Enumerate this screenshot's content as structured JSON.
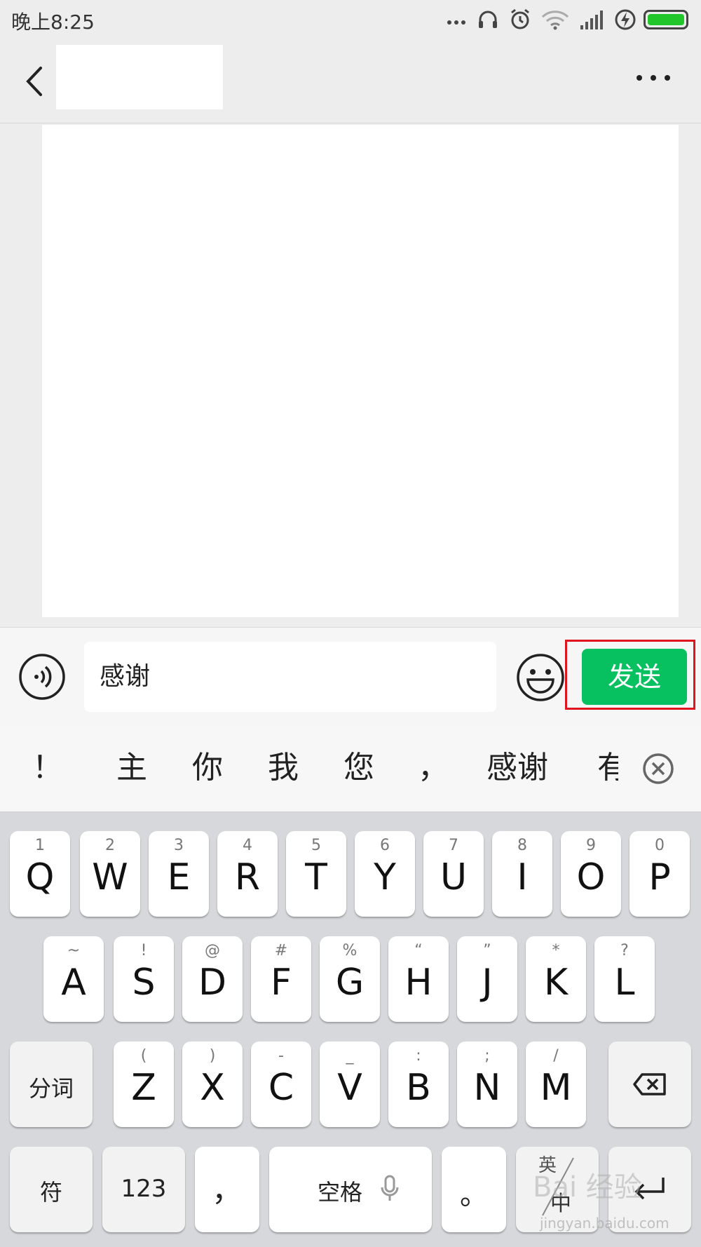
{
  "status_bar": {
    "time": "晚上8:25",
    "icons": [
      "more-dots-icon",
      "headset-icon",
      "alarm-icon",
      "wifi-icon",
      "signal-icon",
      "charging-icon",
      "battery-icon"
    ],
    "battery_color": "#21c62a"
  },
  "header": {
    "back_icon": "chevron-left-icon",
    "more_icon": "more-horizontal-icon"
  },
  "input_bar": {
    "message_value": "感谢",
    "send_label": "发送",
    "send_color": "#07c160",
    "highlight_color": "#e0141e"
  },
  "candidates": {
    "items": [
      "！",
      "主",
      "你",
      "我",
      "您",
      "，",
      "感谢",
      "有"
    ]
  },
  "keyboard": {
    "row1": [
      {
        "letter": "Q",
        "hint": "1"
      },
      {
        "letter": "W",
        "hint": "2"
      },
      {
        "letter": "E",
        "hint": "3"
      },
      {
        "letter": "R",
        "hint": "4"
      },
      {
        "letter": "T",
        "hint": "5"
      },
      {
        "letter": "Y",
        "hint": "6"
      },
      {
        "letter": "U",
        "hint": "7"
      },
      {
        "letter": "I",
        "hint": "8"
      },
      {
        "letter": "O",
        "hint": "9"
      },
      {
        "letter": "P",
        "hint": "0"
      }
    ],
    "row2": [
      {
        "letter": "A",
        "hint": "~"
      },
      {
        "letter": "S",
        "hint": "!"
      },
      {
        "letter": "D",
        "hint": "@"
      },
      {
        "letter": "F",
        "hint": "#"
      },
      {
        "letter": "G",
        "hint": "%"
      },
      {
        "letter": "H",
        "hint": "“"
      },
      {
        "letter": "J",
        "hint": "”"
      },
      {
        "letter": "K",
        "hint": "*"
      },
      {
        "letter": "L",
        "hint": "?"
      }
    ],
    "row3": [
      {
        "letter": "Z",
        "hint": "("
      },
      {
        "letter": "X",
        "hint": ")"
      },
      {
        "letter": "C",
        "hint": "-"
      },
      {
        "letter": "V",
        "hint": "_"
      },
      {
        "letter": "B",
        "hint": ":"
      },
      {
        "letter": "N",
        "hint": ";"
      },
      {
        "letter": "M",
        "hint": "/"
      }
    ],
    "segment_label": "分词",
    "symbol_label": "符",
    "numeric_label": "123",
    "comma_label": "，",
    "space_label": "空格",
    "period_label": "。",
    "lang_label_top": "英",
    "lang_label_bottom": "中"
  },
  "watermark": {
    "text": "Bai 经验",
    "sub": "jingyan.baidu.com"
  }
}
